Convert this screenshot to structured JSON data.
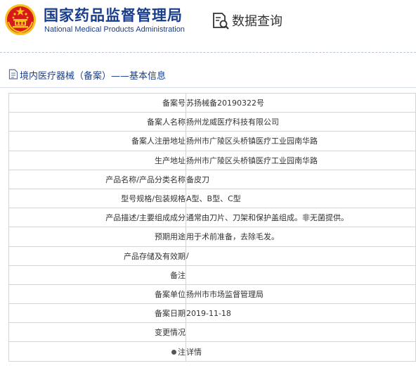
{
  "header": {
    "agency_name_cn": "国家药品监督管理局",
    "agency_name_en": "National Medical Products Administration",
    "data_query_label": "数据查询"
  },
  "breadcrumb": {
    "text": "境内医疗器械（备案）——基本信息"
  },
  "colors": {
    "brand_blue": "#1a3e8c",
    "link_blue": "#1f6fb5",
    "emblem_red": "#d7191c",
    "emblem_gold": "#f6c21b"
  },
  "details": [
    {
      "label": "备案号",
      "value": "苏扬械备20190322号"
    },
    {
      "label": "备案人名称",
      "value": "扬州龙威医疗科技有限公司"
    },
    {
      "label": "备案人注册地址",
      "value": "扬州市广陵区头桥镇医疗工业园南华路"
    },
    {
      "label": "生产地址",
      "value": "扬州市广陵区头桥镇医疗工业园南华路"
    },
    {
      "label": "产品名称/产品分类名称",
      "value": "备皮刀"
    },
    {
      "label": "型号规格/包装规格",
      "value": "A型、B型、C型"
    },
    {
      "label": "产品描述/主要组成成分",
      "value": "通常由刀片、刀架和保护盖组成。非无菌提供。"
    },
    {
      "label": "预期用途",
      "value": "用于术前准备，去除毛发。"
    },
    {
      "label": "产品存储及有效期",
      "value": "/"
    },
    {
      "label": "备注",
      "value": ""
    },
    {
      "label": "备案单位",
      "value": "扬州市市场监督管理局"
    },
    {
      "label": "备案日期",
      "value": "2019-11-18"
    },
    {
      "label": "变更情况",
      "value": ""
    }
  ],
  "note_row": {
    "label": "注",
    "link_text": "详情"
  }
}
